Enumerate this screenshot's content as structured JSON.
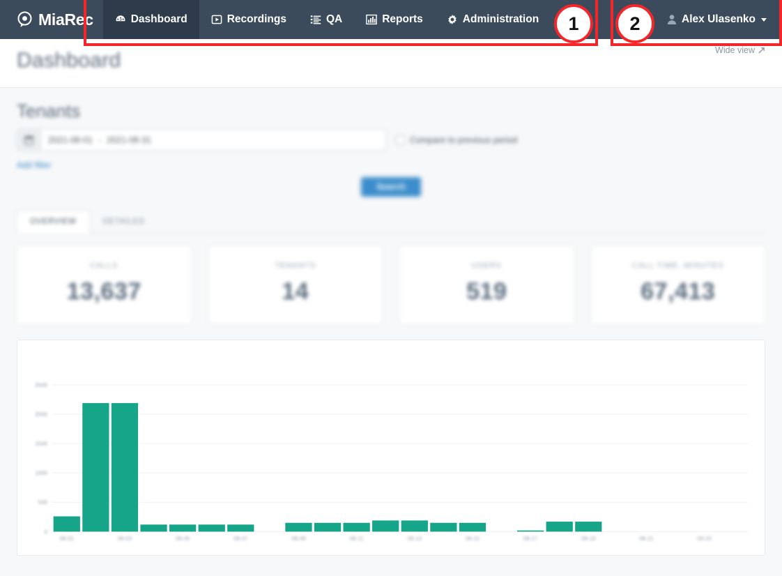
{
  "navbar": {
    "brand": "MiaRec",
    "brand_icon": "miarec-record-logo-icon",
    "items": [
      {
        "label": "Dashboard",
        "icon": "dashboard-gauge-icon",
        "active": true
      },
      {
        "label": "Recordings",
        "icon": "play-square-icon",
        "active": false
      },
      {
        "label": "QA",
        "icon": "list-checklist-icon",
        "active": false
      },
      {
        "label": "Reports",
        "icon": "bar-chart-icon",
        "active": false
      },
      {
        "label": "Administration",
        "icon": "gear-icon",
        "active": false
      }
    ],
    "user": {
      "name": "Alex Ulasenko",
      "icon": "user-avatar-icon",
      "caret": "caret-down-icon"
    }
  },
  "page": {
    "title": "Dashboard",
    "wide_view_label": "Wide view",
    "wide_view_icon": "expand-arrow-icon",
    "section_title": "Tenants"
  },
  "search": {
    "calendar_icon": "calendar-icon",
    "daterange_from": "2021-08-01",
    "daterange_to": "2021-08-31",
    "daterange_separator": "-",
    "compare_label": "Compare to previous period",
    "compare_checked": false,
    "add_filter_label": "Add filter",
    "search_button_label": "Search"
  },
  "tabs": [
    {
      "label": "OVERVIEW",
      "active": true
    },
    {
      "label": "DETAILED",
      "active": false
    }
  ],
  "cards": [
    {
      "label": "CALLS",
      "value": "13,637"
    },
    {
      "label": "TENANTS",
      "value": "14"
    },
    {
      "label": "USERS",
      "value": "519"
    },
    {
      "label": "CALL TIME, MINUTES",
      "value": "67,413"
    }
  ],
  "colors": {
    "navbar": "#3b4b5c",
    "navbar_active": "#2d3b4a",
    "primary_button": "#3c8dcb",
    "chart_bar": "#17a589",
    "annotation": "#f5262a",
    "body_bg": "#f7f8f9"
  },
  "annotations": [
    {
      "number": "1",
      "target": "main-navigation-menu"
    },
    {
      "number": "2",
      "target": "user-account-menu"
    }
  ],
  "chart_data": {
    "type": "bar",
    "title": "",
    "xlabel": "",
    "ylabel": "",
    "grid": true,
    "legend": false,
    "color": "#17a589",
    "ylim": [
      0,
      3000
    ],
    "yticks": [
      0,
      500,
      1000,
      1500,
      2000,
      2500
    ],
    "ytick_labels": [
      "0",
      "500",
      "1000",
      "1500",
      "2000",
      "2500"
    ],
    "categories": [
      "08-01",
      "08-02",
      "08-03",
      "08-04",
      "08-05",
      "08-06",
      "08-07",
      "08-08",
      "08-09",
      "08-10",
      "08-11",
      "08-12",
      "08-13",
      "08-14",
      "08-15",
      "08-16",
      "08-17",
      "08-18",
      "08-19",
      "08-20",
      "08-21",
      "08-22",
      "08-23",
      "08-24"
    ],
    "xtick_labels": [
      "08-01",
      "08-03",
      "08-05",
      "08-07",
      "08-09",
      "08-11",
      "08-13",
      "08-15",
      "08-17",
      "08-19",
      "08-21",
      "08-23"
    ],
    "values": [
      260,
      2190,
      2190,
      120,
      120,
      120,
      120,
      0,
      150,
      150,
      150,
      190,
      190,
      150,
      150,
      0,
      20,
      170,
      170,
      0,
      0,
      0,
      0,
      0
    ]
  }
}
